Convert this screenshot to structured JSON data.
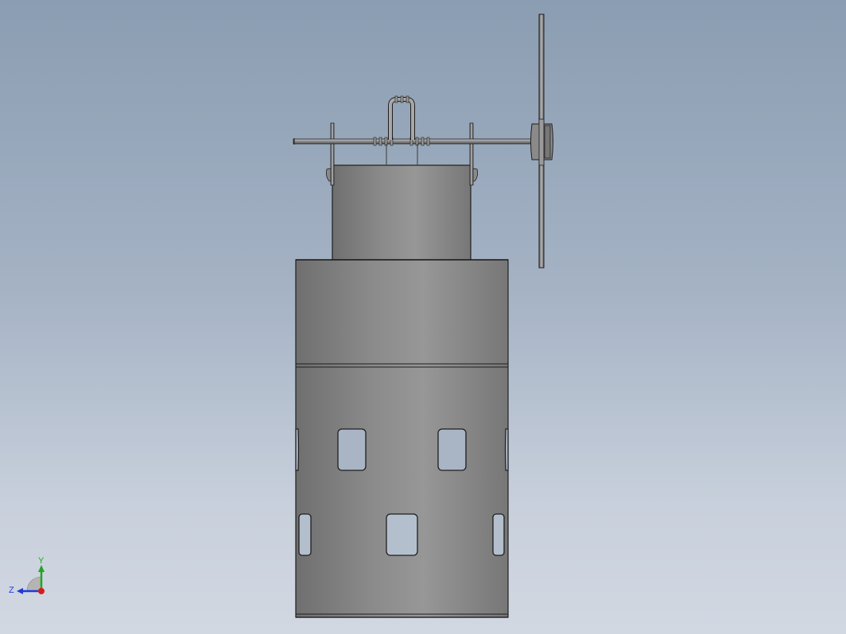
{
  "viewport": {
    "background_top": "#8b9db2",
    "background_bottom": "#d2d8e2",
    "model_color": "#8c8c8c",
    "edge_color": "#1e1e1e"
  },
  "triad": {
    "y_label": "Y",
    "z_label": "Z",
    "y_color": "#1fa81f",
    "z_color": "#1f3ad8",
    "x_color": "#d41e1e"
  }
}
